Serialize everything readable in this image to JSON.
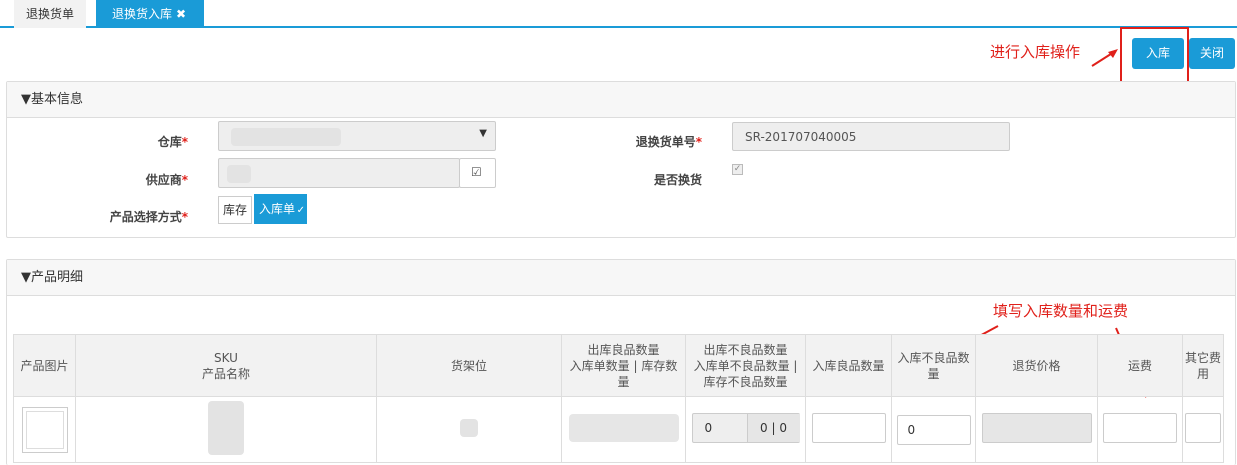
{
  "tabs": [
    {
      "label": "退换货单"
    },
    {
      "label": "退换货入库",
      "close": "✖"
    }
  ],
  "toolbar": {
    "inbound_label": "入库",
    "close_label": "关闭"
  },
  "annotations": {
    "inbound_note": "进行入库操作",
    "fill_note": "填写入库数量和运费"
  },
  "basic": {
    "title": "基本信息",
    "warehouse_label": "仓库",
    "supplier_label": "供应商",
    "mode_label": "产品选择方式",
    "return_no_label": "退换货单号",
    "return_no": "SR-201707040005",
    "exchange_label": "是否换货",
    "mode_options": [
      "库存",
      "入库单"
    ],
    "required_mark": "*"
  },
  "detail": {
    "title": "产品明细",
    "columns": [
      [
        "产品图片"
      ],
      [
        "SKU",
        "产品名称"
      ],
      [
        "货架位"
      ],
      [
        "出库良品数量",
        "入库单数量 | 库存数",
        "量"
      ],
      [
        "出库不良品数量",
        "入库单不良品数量 |",
        "库存不良品数量"
      ],
      [
        "入库良品数量"
      ],
      [
        "入库不良品数",
        "量"
      ],
      [
        "退货价格"
      ],
      [
        "运费"
      ],
      [
        "其它费",
        "用"
      ]
    ],
    "row": {
      "out_bad_value": "0",
      "out_bad_stock": "0 | 0",
      "in_bad_value": "0"
    }
  },
  "colors": {
    "accent": "#1a9bd7",
    "annotation": "#e0201a"
  }
}
